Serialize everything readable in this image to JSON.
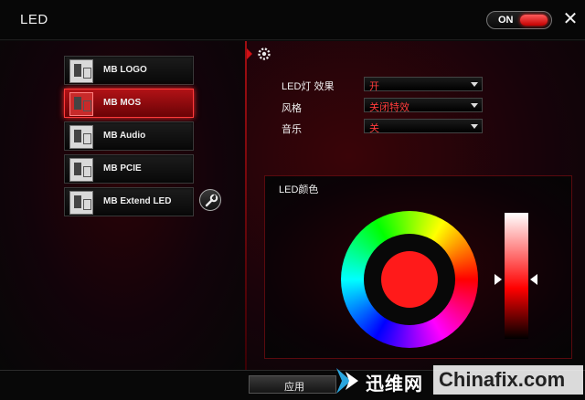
{
  "window": {
    "title": "LED",
    "toggle_label": "ON",
    "toggle_on": true
  },
  "devices": [
    {
      "label": "MB LOGO",
      "active": false
    },
    {
      "label": "MB MOS",
      "active": true
    },
    {
      "label": "MB Audio",
      "active": false
    },
    {
      "label": "MB PCIE",
      "active": false
    },
    {
      "label": "MB Extend LED",
      "active": false
    }
  ],
  "settings": {
    "led_effect": {
      "label": "LED灯 效果",
      "value": "开"
    },
    "style": {
      "label": "风格",
      "value": "关闭特效"
    },
    "music": {
      "label": "音乐",
      "value": "关"
    }
  },
  "color_panel": {
    "title": "LED颜色",
    "selected_color": "#ff1a1a"
  },
  "footer": {
    "apply_label": "应用"
  },
  "watermark": {
    "cn_text": "迅维网",
    "en_text": "Chinafix.com"
  },
  "colors": {
    "accent": "#d01015",
    "select_text": "#ff3b3b"
  }
}
